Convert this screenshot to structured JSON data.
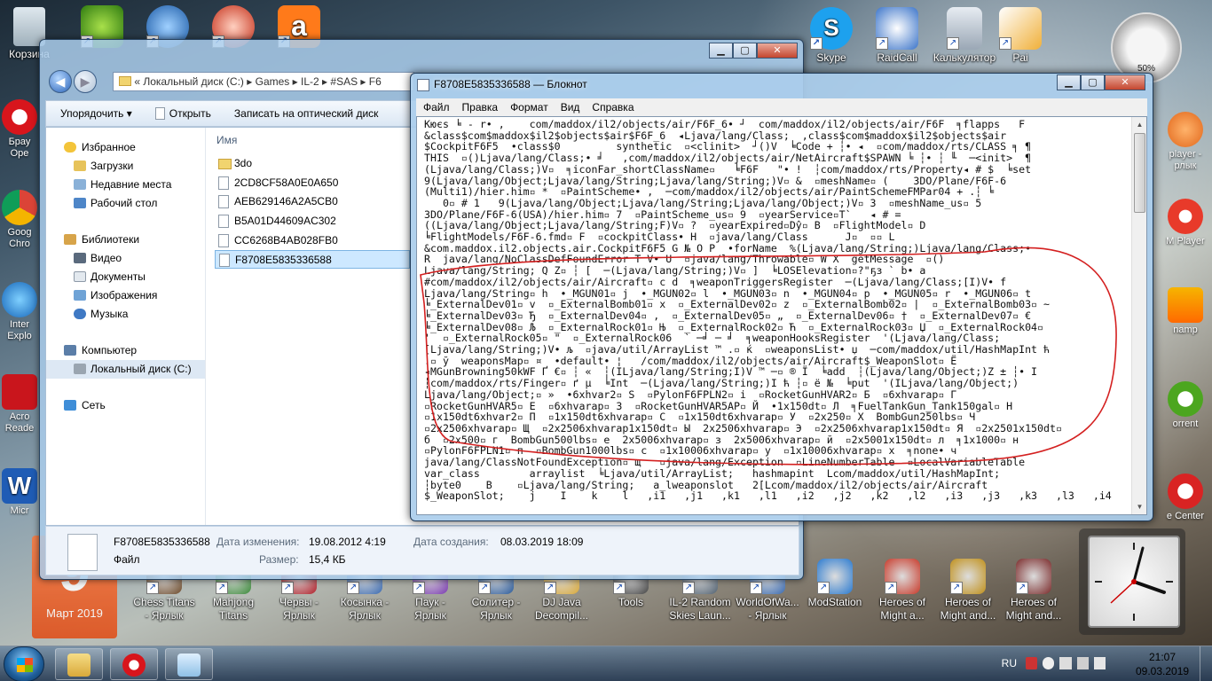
{
  "desktop": {
    "top_icons": [
      {
        "label": "Корзина",
        "icon": "recycle-bin-icon"
      },
      {
        "label": "",
        "icon": "antivirus-icon"
      },
      {
        "label": "",
        "icon": "network-icon"
      },
      {
        "label": "",
        "icon": "ccleaner-icon"
      },
      {
        "label": "",
        "icon": "avast-icon"
      },
      {
        "label": "Skype",
        "icon": "skype-icon"
      },
      {
        "label": "RaidCall",
        "icon": "raidcall-icon"
      },
      {
        "label": "Калькулятор",
        "icon": "calculator-icon"
      },
      {
        "label": "Pai",
        "icon": "paint-icon"
      }
    ],
    "left_icons": [
      {
        "label": "Брау",
        "label2": "Ope",
        "icon": "opera-browser-icon"
      },
      {
        "label": "Goog",
        "label2": "Chro",
        "icon": "chrome-icon"
      },
      {
        "label": "Inter",
        "label2": "Explo",
        "icon": "ie-icon"
      },
      {
        "label": "Acro",
        "label2": "Reade",
        "icon": "acrobat-icon"
      },
      {
        "label": "",
        "label2": "Micr",
        "icon": "word-icon"
      }
    ],
    "right_icons": [
      {
        "label": "player -",
        "label2": "рлык",
        "icon": "media-player-icon"
      },
      {
        "label": "M Player",
        "label2": "",
        "icon": "kmplayer-icon"
      },
      {
        "label": "namp",
        "label2": "",
        "icon": "winamp-icon"
      },
      {
        "label": "orrent",
        "label2": "",
        "icon": "utorrent-icon"
      },
      {
        "label": "e Center",
        "label2": "",
        "icon": "center-icon"
      }
    ],
    "bottom_icons": [
      {
        "label": "Chess Titans",
        "label2": "- Ярлык",
        "icon": "chess-icon"
      },
      {
        "label": "Mahjong",
        "label2": "Titans",
        "icon": "mahjong-icon"
      },
      {
        "label": "Червы -",
        "label2": "Ярлык",
        "icon": "hearts-icon"
      },
      {
        "label": "Косынка -",
        "label2": "Ярлык",
        "icon": "solitaire-icon"
      },
      {
        "label": "Паук -",
        "label2": "Ярлык",
        "icon": "spider-icon"
      },
      {
        "label": "Солитер -",
        "label2": "Ярлык",
        "icon": "freecell-icon"
      },
      {
        "label": "DJ Java",
        "label2": "Decompil...",
        "icon": "decompiler-icon"
      },
      {
        "label": "Tools",
        "label2": "",
        "icon": "tools-icon"
      },
      {
        "label": "IL-2 Random",
        "label2": "Skies Laun...",
        "icon": "il2-icon"
      },
      {
        "label": "WorldOfWa...",
        "label2": "- Ярлык",
        "icon": "wows-icon"
      },
      {
        "label": "ModStation",
        "label2": "",
        "icon": "modstation-icon"
      },
      {
        "label": "Heroes of",
        "label2": "Might a...",
        "icon": "heroes-icon"
      },
      {
        "label": "Heroes of",
        "label2": "Might and...",
        "icon": "heroes-icon"
      },
      {
        "label": "Heroes of",
        "label2": "Might and...",
        "icon": "heroes-icon"
      }
    ],
    "calendar": {
      "day": "9",
      "month": "Март 2019"
    },
    "gauge_percent": "50%"
  },
  "explorer": {
    "address": [
      "Локальный диск (C:)",
      "Games",
      "IL-2",
      "#SAS",
      "F6"
    ],
    "toolbar": {
      "organize": "Упорядочить",
      "open": "Открыть",
      "burn": "Записать на оптический диск"
    },
    "nav": {
      "favorites": "Избранное",
      "downloads": "Загрузки",
      "recent": "Недавние места",
      "desktop": "Рабочий стол",
      "libraries": "Библиотеки",
      "video": "Видео",
      "documents": "Документы",
      "images": "Изображения",
      "music": "Музыка",
      "computer": "Компьютер",
      "local_disk": "Локальный диск (C:)",
      "network": "Сеть"
    },
    "column_name": "Имя",
    "files": [
      {
        "name": "3do",
        "type": "folder"
      },
      {
        "name": "2CD8CF58A0E0A650",
        "type": "file"
      },
      {
        "name": "AEB629146A2A5CB0",
        "type": "file"
      },
      {
        "name": "B5A01D44609AC302",
        "type": "file"
      },
      {
        "name": "CC6268B4AB028FB0",
        "type": "file"
      },
      {
        "name": "F8708E5835336588",
        "type": "file"
      }
    ],
    "details": {
      "filename": "F8708E5835336588",
      "type": "Файл",
      "modified_label": "Дата изменения:",
      "modified_value": "19.08.2012 4:19",
      "size_label": "Размер:",
      "size_value": "15,4 КБ",
      "created_label": "Дата создания:",
      "created_value": "08.03.2019 18:09"
    },
    "caption": {
      "min": "▁",
      "max": "▢",
      "close": "✕"
    }
  },
  "notepad": {
    "title": "F8708E5835336588 — Блокнот",
    "menu": [
      "Файл",
      "Правка",
      "Формат",
      "Вид",
      "Справка"
    ],
    "lines": [
      "Кюєѕ ╘ - r• ,    com/maddox/il2/objects/air/F6F_6• ┘  com/maddox/il2/objects/air/F6F  ╕flapps   F",
      "&class$com$maddox$il2$objects$air$F6F_6  ◂Ljava/lang/Class;  ,class$com$maddox$il2$objects$air",
      "$CockpitF6F5  •class$0         synthetic  ▫<clinit>  ┘()V  ╘Code + ┆• ◂  ▫com/maddox/rts/CLASS ╕ ¶",
      "THIS  ▫()Ljava/lang/Class;• ╛   ,com/maddox/il2/objects/air/NetAircraft$SPAWN ╘ ┆• ┆ ╙  ─<init>  ¶",
      "(Ljava/lang/Class;)V▫  ╕iconFar_shortClassName▫   ╘F6F   \"• !  ┆com/maddox/rts/Property◂ # $  ╘set",
      "9(Ljava/lang/Object;Ljava/lang/String;Ljava/lang/String;)V▫ &  ▫meshName▫ (    3DO/Plane/F6F-6",
      "(Multi1)/hier.him▫ *  ▫PaintScheme• ,  ─com/maddox/il2/objects/air/PaintSchemeFMPar04 + .┆ ╘",
      "   0▫ # 1   9(Ljava/lang/Object;Ljava/lang/String;Ljava/lang/Object;)V▫ 3  ▫meshName_us▫ 5",
      "3DO/Plane/F6F-6(USA)/hier.him▫ 7  ▫PaintScheme_us▫ 9  ▫yearService▫T`   ◂ # =",
      "((Ljava/lang/Object;Ljava/lang/String;F)V▫ ?  ▫yearExpired▫Dŷ▫ B  ▫FlightModel▫ D",
      "╘FlightModels/F6F-6.fmd▫ F  ▫cockpitClass• H  ▫java/lang/Class      J▫  ▫▫ L",
      "&com.maddox.il2.objects.air.CockpitF6F5 G № O P  •forName  %(Ljava/lang/String;)Ljava/lang/Class;•",
      "R  java/lang/NoClassDefFoundError T V• U  ▫java/lang/Throwable▫ W X  getMessage  ▫()",
      "Ljava/lang/String; Q Z▫ ┆ [  ─(Ljava/lang/String;)V▫ ]  ╘LOSElevation▫?\"ҕз ` b• a",
      "#com/maddox/il2/objects/air/Aircraft▫ c d  ╕weaponTriggersRegister  ─(Ljava/lang/Class;[I)V• f",
      "Ljava/lang/String▫ h  •_MGUN01▫ j  •_MGUN02▫ l  •_MGUN03▫ n  •_MGUN04▫ p  •_MGUN05▫ r  •_MGUN06▫ t",
      "╘_ExternalDev01▫ v  ▫_ExternalBomb01▫ x  ▫_ExternalDev02▫ z  ▫_ExternalBomb02▫ |  ▫_ExternalBomb03▫ ~",
      "╘_ExternalDev03▫ Ђ  ▫_ExternalDev04▫ ,  ▫_ExternalDev05▫ „  ▫_ExternalDev06▫ †  ▫_ExternalDev07▫ €",
      "╘_ExternalDev08▫ Љ  ▫_ExternalRock01▫ Њ  ▫_ExternalRock02▫ Ћ  ▫_ExternalRock03▫ Џ  ▫_ExternalRock04▫",
      "'  ▫_ExternalRock05▫ \"  ▫_ExternalRock06  ` ─╛ ─ ╛  ╕weaponHooksRegister  '(Ljava/lang/Class;",
      "[Ljava/lang/String;)V• љ  ▫java/util/ArrayList ™ .▫ ќ  ▫weaponsList• џ  ─com/maddox/util/HashMapInt ћ",
      ".▫ ў  weaponsMap▫ ¤  •default• ¦   /com/maddox/il2/objects/air/Aircraft$_WeaponSlot▫ Ё",
      "◂MGunBrowning50kWF Ґ €▫ ┆ «  ┆(ILjava/lang/String;I)V ™ ─▫ ® Ї  ╘add  ┆(Ljava/lang/Object;)Z ± ┆• І",
      "┆com/maddox/rts/Finger▫ ґ µ  ╘Int  ─(Ljava/lang/String;)I ћ ┆▫ ё №  ╘put  '(ILjava/lang/Object;)",
      "Ljava/lang/Object;▫ »  •6xhvar2▫ Ѕ  ▫PylonF6FPLN2▫ і  ▫RocketGunHVAR2▫ Б  ▫6xhvarap▫ Г",
      "▫RocketGunHVAR5▫ Е  ▫6xhvarap▫ З  ▫RocketGunHVAR5AP▫ Й  •1x150dt▫ Л  ╕FuelTankGun_Tank150gal▫ Н",
      "▫1x150dt6xhvar2▫ П  ▫1x150dt6xhvarap▫ С  ▫1x150dt6xhvarap▫ У  ▫2x250▫ Х  BombGun250lbs▫ Ч",
      "▫2x2506xhvarap▫ Щ  ▫2x2506xhvarap1x150dt▫ Ы  2x2506xhvarap▫ Э  ▫2x2506xhvarap1x150dt▫ Я  ▫2x2501x150dt▫",
      "б  ▫2x500▫ г  BombGun500lbs▫ е  2x5006xhvarap▫ з  2x5006xhvarap▫ й  ▫2x5001x150dt▫ л  ╕1x1000▫ н",
      "▫PylonF6FPLN1▫ п  ▫BombGun1000lbs▫ с  ▫1x10006xhvarap▫ у  ▫1x10006xhvarap▫ х  ╕none• ч",
      "java/lang/ClassNotFoundException▫ щ   ▫java/lang/Exception  ▫LineNumberTable  ▫LocalVariableTable",
      "var_class        arraylist  ╘Ljava/util/ArrayList;   hashmapint  Lcom/maddox/util/HashMapInt;",
      "┆byte0    B    ▫Ljava/lang/String;   a_lweaponslot   2[Lcom/maddox/il2/objects/air/Aircraft",
      "$_WeaponSlot;    j    I    k    l   ,i1   ,j1   ,k1   ,l1   ,i2   ,j2   ,k2   ,l2   ,i3   ,j3   ,k3   ,l3   ,i4"
    ],
    "caption": {
      "min": "▁",
      "max": "▢",
      "close": "✕"
    }
  },
  "taskbar": {
    "lang": "RU",
    "time": "21:07",
    "date": "09.03.2019",
    "pinned": [
      "explorer-icon",
      "opera-icon",
      "notepad-icon"
    ]
  },
  "colors": {
    "accent": "#2a63b8",
    "annotation_red": "#d42020",
    "calendar": "#e85a1c"
  }
}
